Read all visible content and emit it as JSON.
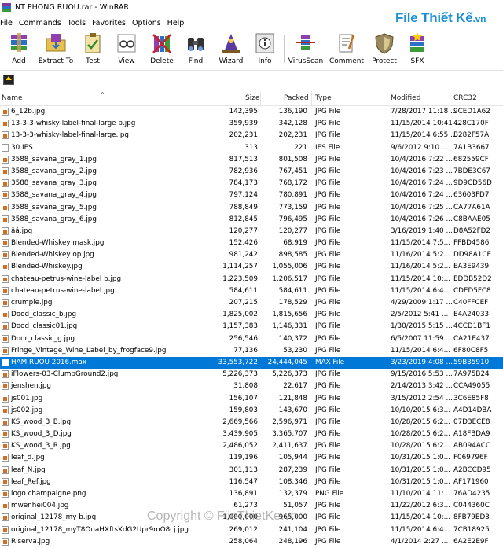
{
  "window": {
    "title": "NT PHONG RUOU.rar - WinRAR"
  },
  "watermark": {
    "brand": "File Thiết Kế",
    "tld": ".vn",
    "copyright": "Copyright © FileThietKe.vn"
  },
  "menu": [
    "File",
    "Commands",
    "Tools",
    "Favorites",
    "Options",
    "Help"
  ],
  "toolbar": [
    {
      "label": "Add",
      "icon": "add-archive-icon"
    },
    {
      "label": "Extract To",
      "icon": "extract-folder-icon"
    },
    {
      "label": "Test",
      "icon": "test-clipboard-icon"
    },
    {
      "label": "View",
      "icon": "view-glasses-icon"
    },
    {
      "label": "Delete",
      "icon": "delete-books-icon"
    },
    {
      "label": "Find",
      "icon": "find-binoculars-icon"
    },
    {
      "label": "Wizard",
      "icon": "wizard-icon"
    },
    {
      "label": "Info",
      "icon": "info-icon"
    },
    {
      "label": "VirusScan",
      "icon": "virus-scan-icon"
    },
    {
      "label": "Comment",
      "icon": "comment-icon"
    },
    {
      "label": "Protect",
      "icon": "protect-shield-icon"
    },
    {
      "label": "SFX",
      "icon": "sfx-icon"
    }
  ],
  "columns": {
    "name": "Name",
    "size": "Size",
    "packed": "Packed",
    "type": "Type",
    "modified": "Modified",
    "crc": "CRC32"
  },
  "files": [
    {
      "name": "6_12b.jpg",
      "size": "142,395",
      "packed": "136,190",
      "type": "JPG File",
      "modified": "7/28/2017 11:18 ...",
      "crc": "9CED1A62"
    },
    {
      "name": "13-3-3-whisky-label-final-large b.jpg",
      "size": "359,939",
      "packed": "342,128",
      "type": "JPG File",
      "modified": "11/15/2014 10:41 ...",
      "crc": "428C170F"
    },
    {
      "name": "13-3-3-whisky-label-final-large.jpg",
      "size": "202,231",
      "packed": "202,231",
      "type": "JPG File",
      "modified": "11/15/2014 6:55 ...",
      "crc": "B282F57A"
    },
    {
      "name": "30.IES",
      "size": "313",
      "packed": "221",
      "type": "IES File",
      "modified": "9/6/2012 9:10 ...",
      "crc": "7A1B3667"
    },
    {
      "name": "3588_savana_gray_1.jpg",
      "size": "817,513",
      "packed": "801,508",
      "type": "JPG File",
      "modified": "10/4/2016 7:22 ...",
      "crc": "682559CF"
    },
    {
      "name": "3588_savana_gray_2.jpg",
      "size": "782,936",
      "packed": "767,451",
      "type": "JPG File",
      "modified": "10/4/2016 7:23 ...",
      "crc": "7BDE3C67"
    },
    {
      "name": "3588_savana_gray_3.jpg",
      "size": "784,173",
      "packed": "768,172",
      "type": "JPG File",
      "modified": "10/4/2016 7:24 ...",
      "crc": "9D9CD56D"
    },
    {
      "name": "3588_savana_gray_4.jpg",
      "size": "797,124",
      "packed": "780,891",
      "type": "JPG File",
      "modified": "10/4/2016 7:24 ...",
      "crc": "63603FD7"
    },
    {
      "name": "3588_savana_gray_5.jpg",
      "size": "788,849",
      "packed": "773,159",
      "type": "JPG File",
      "modified": "10/4/2016 7:25 ...",
      "crc": "CA77A61A"
    },
    {
      "name": "3588_savana_gray_6.jpg",
      "size": "812,845",
      "packed": "796,495",
      "type": "JPG File",
      "modified": "10/4/2016 7:26 ...",
      "crc": "C8BAAE05"
    },
    {
      "name": "ââ.jpg",
      "size": "120,277",
      "packed": "120,277",
      "type": "JPG File",
      "modified": "3/16/2019 1:40 ...",
      "crc": "D8A52FD2"
    },
    {
      "name": "Blended-Whiskey mask.jpg",
      "size": "152,426",
      "packed": "68,919",
      "type": "JPG File",
      "modified": "11/15/2014 7:5...",
      "crc": "FFBD4586"
    },
    {
      "name": "Blended-Whiskey op.jpg",
      "size": "981,242",
      "packed": "898,585",
      "type": "JPG File",
      "modified": "11/16/2014 5:2...",
      "crc": "DD98A1CE"
    },
    {
      "name": "Blended-Whiskey.jpg",
      "size": "1,114,257",
      "packed": "1,055,006",
      "type": "JPG File",
      "modified": "11/16/2014 5:2...",
      "crc": "EA3E9439"
    },
    {
      "name": "chateau-petrus-wine-label b.jpg",
      "size": "1,223,509",
      "packed": "1,206,517",
      "type": "JPG File",
      "modified": "11/15/2014 10:...",
      "crc": "EDDB52D2"
    },
    {
      "name": "chateau-petrus-wine-label.jpg",
      "size": "584,611",
      "packed": "584,611",
      "type": "JPG File",
      "modified": "11/15/2014 6:4...",
      "crc": "CDED5FC8"
    },
    {
      "name": "crumple.jpg",
      "size": "207,215",
      "packed": "178,529",
      "type": "JPG File",
      "modified": "4/29/2009 1:17 ...",
      "crc": "C40FFCEF"
    },
    {
      "name": "Dood_classic_b.jpg",
      "size": "1,825,002",
      "packed": "1,815,656",
      "type": "JPG File",
      "modified": "2/5/2012 5:41 ...",
      "crc": "E4A24033"
    },
    {
      "name": "Dood_classic01.jpg",
      "size": "1,157,383",
      "packed": "1,146,331",
      "type": "JPG File",
      "modified": "1/30/2015 5:15 ...",
      "crc": "4CCD1BF1"
    },
    {
      "name": "Door_classic_g.jpg",
      "size": "256,546",
      "packed": "140,372",
      "type": "JPG File",
      "modified": "6/5/2007 11:59 ...",
      "crc": "CA21E437"
    },
    {
      "name": "Fringe_Vintage_Wine_Label_by_frogface9.jpg",
      "size": "77,136",
      "packed": "53,230",
      "type": "JPG File",
      "modified": "11/15/2014 6:4...",
      "crc": "6F80C8F5"
    },
    {
      "name": "HAM RUOU 2016.max",
      "size": "33,553,722",
      "packed": "24,444,045",
      "type": "MAX File",
      "modified": "3/23/2019 4:08 ...",
      "crc": "59B35910",
      "selected": true
    },
    {
      "name": "iFlowers-03-ClumpGround2.jpg",
      "size": "5,226,373",
      "packed": "5,226,373",
      "type": "JPG File",
      "modified": "9/15/2016 5:53 ...",
      "crc": "7A975B24"
    },
    {
      "name": "jenshen.jpg",
      "size": "31,808",
      "packed": "22,617",
      "type": "JPG File",
      "modified": "2/14/2013 3:42 ...",
      "crc": "CCA49055"
    },
    {
      "name": "js001.jpg",
      "size": "156,107",
      "packed": "121,848",
      "type": "JPG File",
      "modified": "3/15/2012 2:54 ...",
      "crc": "3C6E85F8"
    },
    {
      "name": "js002.jpg",
      "size": "159,803",
      "packed": "143,670",
      "type": "JPG File",
      "modified": "10/10/2015 6:3...",
      "crc": "A4D14DBA"
    },
    {
      "name": "KS_wood_3_B.jpg",
      "size": "2,669,566",
      "packed": "2,596,971",
      "type": "JPG File",
      "modified": "10/28/2015 6:2...",
      "crc": "07D3ECE8"
    },
    {
      "name": "KS_wood_3_D.jpg",
      "size": "3,439,905",
      "packed": "3,365,707",
      "type": "JPG File",
      "modified": "10/28/2015 6:2...",
      "crc": "A18FBDA9"
    },
    {
      "name": "KS_wood_3_R.jpg",
      "size": "2,486,052",
      "packed": "2,411,637",
      "type": "JPG File",
      "modified": "10/28/2015 6:2...",
      "crc": "AB094ACC"
    },
    {
      "name": "leaf_d.jpg",
      "size": "119,196",
      "packed": "105,944",
      "type": "JPG File",
      "modified": "10/31/2015 1:0...",
      "crc": "F069796F"
    },
    {
      "name": "leaf_N.jpg",
      "size": "301,113",
      "packed": "287,239",
      "type": "JPG File",
      "modified": "10/31/2015 1:0...",
      "crc": "A2BCCD95"
    },
    {
      "name": "leaf_Ref.jpg",
      "size": "116,547",
      "packed": "108,346",
      "type": "JPG File",
      "modified": "10/31/2015 1:0...",
      "crc": "AF171960"
    },
    {
      "name": "logo champaigne.png",
      "size": "136,891",
      "packed": "132,379",
      "type": "PNG File",
      "modified": "11/10/2014 11:...",
      "crc": "76AD4235"
    },
    {
      "name": "mwenhei004.jpg",
      "size": "61,273",
      "packed": "51,057",
      "type": "JPG File",
      "modified": "11/22/2012 6:3...",
      "crc": "C044360C"
    },
    {
      "name": "original_12178_my b.jpg",
      "size": "1,000,000",
      "packed": "965,000",
      "type": "JPG File",
      "modified": "11/15/2014 10:...",
      "crc": "8FB79ED3"
    },
    {
      "name": "original_12178_myT8OuaHXftsXdG2Upr9mO8cj.jpg",
      "size": "269,012",
      "packed": "241,104",
      "type": "JPG File",
      "modified": "11/15/2014 6:4...",
      "crc": "7CB18925"
    },
    {
      "name": "Riserva.jpg",
      "size": "258,064",
      "packed": "248,196",
      "type": "JPG File",
      "modified": "4/1/2014 2:27 ...",
      "crc": "6A2E2E9F"
    }
  ]
}
